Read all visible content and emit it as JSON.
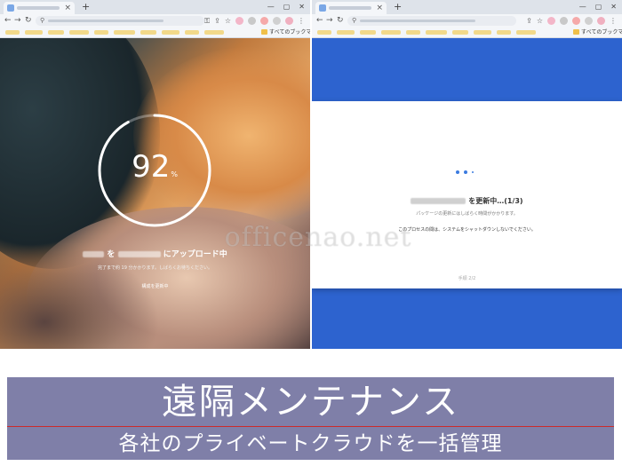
{
  "left_window": {
    "tab_close": "×",
    "new_tab": "+",
    "window_controls": [
      "—",
      "▢",
      "✕"
    ],
    "bookmarks_label": "すべてのブックマーク",
    "progress": {
      "value": "92",
      "unit": "%",
      "fraction": 0.92
    },
    "upload_title_mid": "を",
    "upload_title_end": "にアップロード中",
    "upload_sub": "完了まで約 19 分かかります。しばらくお待ちください。",
    "upload_status": "構成を更新中"
  },
  "right_window": {
    "tab_close": "×",
    "new_tab": "+",
    "window_controls": [
      "—",
      "▢",
      "✕"
    ],
    "bookmarks_label": "すべてのブックマーク",
    "update_title": "を更新中…(1/3)",
    "update_sub": "パッケージの更新にはしばらく時間がかかります。",
    "update_warn": "このプロセスの間は、システムをシャットダウンしないでください。",
    "update_step": "手順 2/2"
  },
  "watermark": "officenao.net",
  "banner": {
    "title": "遠隔メンテナンス",
    "subtitle": "各社のプライベートクラウドを一括管理"
  },
  "colors": {
    "update_bg": "#2d63cf",
    "banner_bg": "#7f7fa8",
    "banner_rule": "#cc2b2b",
    "loader_dot": "#3b7be0"
  }
}
